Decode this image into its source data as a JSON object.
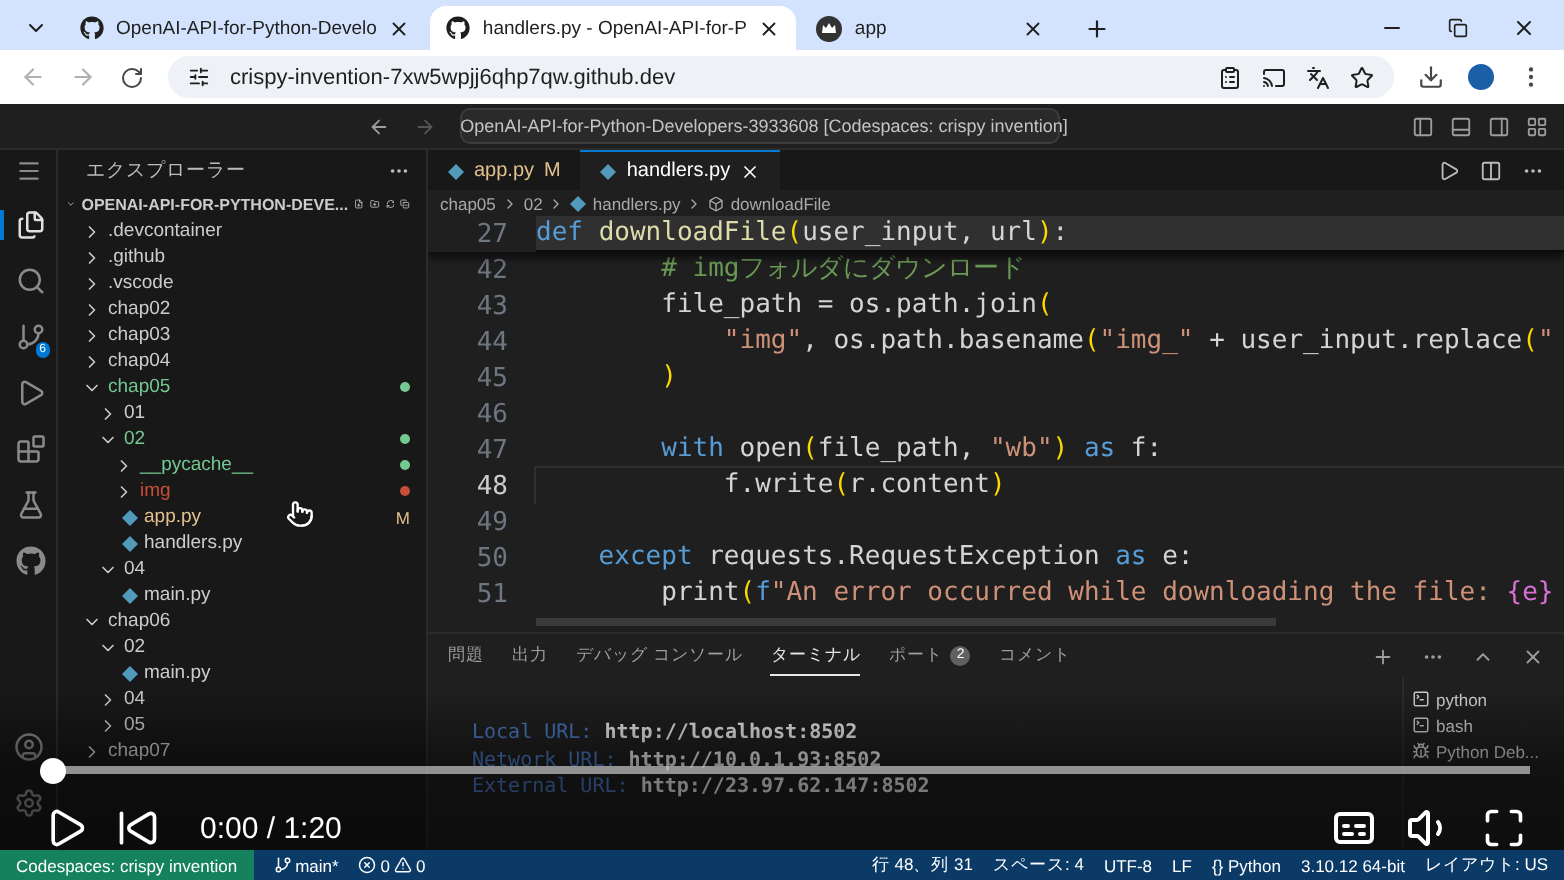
{
  "browser": {
    "tabs": [
      {
        "title": "OpenAI-API-for-Python-Develo",
        "selected": false
      },
      {
        "title": "handlers.py - OpenAI-API-for-P",
        "selected": true
      },
      {
        "title": "app",
        "selected": false
      }
    ],
    "url": "crispy-invention-7xw5wpjj6qhp7qw.github.dev"
  },
  "vscode": {
    "command_center": "OpenAI-API-for-Python-Developers-3933608 [Codespaces: crispy invention]",
    "activity_bar": [
      {
        "selected": true
      },
      {
        "selected": false
      },
      {
        "selected": false,
        "badge": "6"
      },
      {
        "selected": false
      },
      {
        "selected": false
      },
      {
        "selected": false
      },
      {
        "selected": false
      }
    ],
    "sidebar": {
      "title": "エクスプローラー",
      "root": "OPENAI-API-FOR-PYTHON-DEVE...",
      "tree": [
        {
          "name": ".devcontainer",
          "kind": "folder",
          "expanded": false
        },
        {
          "name": ".github",
          "kind": "folder",
          "expanded": false
        },
        {
          "name": ".vscode",
          "kind": "folder",
          "expanded": false
        },
        {
          "name": "chap02",
          "kind": "folder",
          "expanded": false
        },
        {
          "name": "chap03",
          "kind": "folder",
          "expanded": false
        },
        {
          "name": "chap04",
          "kind": "folder",
          "expanded": false
        },
        {
          "name": "chap05",
          "kind": "folder",
          "expanded": true,
          "color": "#73c991",
          "children": [
            {
              "name": "01",
              "kind": "folder",
              "expanded": false
            },
            {
              "name": "02",
              "kind": "folder",
              "expanded": true,
              "color": "#73c991",
              "children": [
                {
                  "name": "__pycache__",
                  "kind": "folder",
                  "expanded": false,
                  "color": "#73c991"
                },
                {
                  "name": "img",
                  "kind": "folder",
                  "expanded": false,
                  "color": "#c74e39"
                },
                {
                  "name": "app.py",
                  "kind": "file",
                  "color": "#e2c08d",
                  "badge": "M"
                },
                {
                  "name": "handlers.py",
                  "kind": "file"
                }
              ]
            },
            {
              "name": "04",
              "kind": "folder",
              "expanded": true,
              "children": [
                {
                  "name": "main.py",
                  "kind": "file"
                }
              ]
            }
          ]
        },
        {
          "name": "chap06",
          "kind": "folder",
          "expanded": true,
          "children": [
            {
              "name": "02",
              "kind": "folder",
              "expanded": true,
              "children": [
                {
                  "name": "main.py",
                  "kind": "file"
                }
              ]
            },
            {
              "name": "04",
              "kind": "folder",
              "expanded": false
            },
            {
              "name": "05",
              "kind": "folder",
              "expanded": false
            }
          ]
        },
        {
          "name": "chap07",
          "kind": "folder",
          "expanded": false
        }
      ]
    },
    "editor": {
      "tabs": [
        {
          "name": "app.py",
          "badge": "M",
          "selected": false
        },
        {
          "name": "handlers.py",
          "selected": true
        }
      ],
      "breadcrumb": [
        "chap05",
        "02",
        "handlers.py",
        "downloadFile"
      ],
      "lines": [
        {
          "number": "27",
          "sticky": true,
          "current": false,
          "tokens": [
            {
              "kind": "kw",
              "text": "def "
            },
            {
              "kind": "fn",
              "text": "downloadFile"
            },
            {
              "kind": "paren",
              "text": "("
            },
            {
              "kind": "plain",
              "text": "user_input, url"
            },
            {
              "kind": "paren",
              "text": ")"
            },
            {
              "kind": "plain",
              "text": ":"
            }
          ]
        },
        {
          "number": "42",
          "sticky": false,
          "current": false,
          "tokens": [
            {
              "kind": "cm",
              "text": "        # imgフォルダにダウンロード"
            }
          ]
        },
        {
          "number": "43",
          "sticky": false,
          "current": false,
          "tokens": [
            {
              "kind": "plain",
              "text": "        file_path = os.path.join"
            },
            {
              "kind": "paren",
              "text": "("
            }
          ]
        },
        {
          "number": "44",
          "sticky": false,
          "current": false,
          "tokens": [
            {
              "kind": "str",
              "text": "            \"img\""
            },
            {
              "kind": "plain",
              "text": ", os.path.basename"
            },
            {
              "kind": "paren",
              "text": "("
            },
            {
              "kind": "str",
              "text": "\"img_\""
            },
            {
              "kind": "plain",
              "text": " + user_input.replace"
            },
            {
              "kind": "paren",
              "text": "("
            },
            {
              "kind": "str",
              "text": "\""
            }
          ]
        },
        {
          "number": "45",
          "sticky": false,
          "current": false,
          "tokens": [
            {
              "kind": "paren",
              "text": "        )"
            }
          ]
        },
        {
          "number": "46",
          "sticky": false,
          "current": false
        },
        {
          "number": "47",
          "sticky": false,
          "current": false,
          "tokens": [
            {
              "kind": "kw",
              "text": "        with"
            },
            {
              "kind": "plain",
              "text": " open"
            },
            {
              "kind": "paren",
              "text": "("
            },
            {
              "kind": "plain",
              "text": "file_path, "
            },
            {
              "kind": "str",
              "text": "\"wb\""
            },
            {
              "kind": "paren",
              "text": ") "
            },
            {
              "kind": "kw",
              "text": "as"
            },
            {
              "kind": "plain",
              "text": " f:"
            }
          ]
        },
        {
          "number": "48",
          "sticky": false,
          "current": true,
          "tokens": [
            {
              "kind": "plain",
              "text": "            f.write"
            },
            {
              "kind": "paren",
              "text": "("
            },
            {
              "kind": "plain",
              "text": "r.content"
            },
            {
              "kind": "paren",
              "text": ")"
            }
          ]
        },
        {
          "number": "49",
          "sticky": false,
          "current": false
        },
        {
          "number": "50",
          "sticky": false,
          "current": false,
          "tokens": [
            {
              "kind": "kw",
              "text": "    except"
            },
            {
              "kind": "plain",
              "text": " requests.RequestException "
            },
            {
              "kind": "kw",
              "text": "as"
            },
            {
              "kind": "plain",
              "text": " e:"
            }
          ]
        },
        {
          "number": "51",
          "sticky": false,
          "current": false,
          "tokens": [
            {
              "kind": "plain",
              "text": "        print"
            },
            {
              "kind": "paren",
              "text": "("
            },
            {
              "kind": "kw",
              "text": "f"
            },
            {
              "kind": "str",
              "text": "\"An error occurred while downloading the file: "
            },
            {
              "kind": "brace",
              "text": "{e}"
            }
          ]
        }
      ]
    },
    "panel": {
      "tabs": [
        {
          "label": "問題",
          "selected": false
        },
        {
          "label": "出力",
          "selected": false
        },
        {
          "label": "デバッグ コンソール",
          "selected": false
        },
        {
          "label": "ターミナル",
          "selected": true
        },
        {
          "label": "ポート",
          "selected": false,
          "badge": "2"
        },
        {
          "label": "コメント",
          "selected": false
        }
      ],
      "terminal": [
        {
          "label": "Local URL:",
          "url": "http://localhost:8502"
        },
        {
          "label": "Network URL:",
          "url": "http://10.0.1.93:8502"
        },
        {
          "label": "External URL:",
          "url": "http://23.97.62.147:8502"
        }
      ],
      "sessions": [
        {
          "name": "python",
          "kind": "shell"
        },
        {
          "name": "bash",
          "kind": "shell"
        },
        {
          "name": "Python Deb...",
          "kind": "debug"
        }
      ]
    },
    "status_bar": {
      "remote": "Codespaces: crispy invention",
      "branch": "main*",
      "errors": "0",
      "warnings": "0",
      "right": [
        "行 48、列 31",
        "スペース: 4",
        "UTF-8",
        "LF",
        "{} Python",
        "3.10.12 64-bit",
        "レイアウト: US"
      ]
    }
  },
  "video": {
    "progress": {
      "level": 0.004
    },
    "time": "0:00 / 1:20"
  }
}
